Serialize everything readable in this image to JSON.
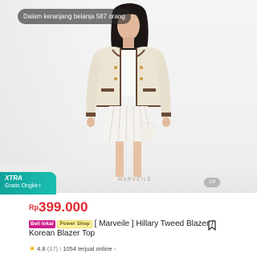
{
  "photo": {
    "cart_badge_prefix": "Dalam keranjang belanja",
    "cart_badge_count": "587",
    "cart_badge_suffix": "orang",
    "watermark": "MARVEILE",
    "page_indicator": "1/9"
  },
  "promo": {
    "xtra_label": "XTRA",
    "shipping_label": "Gratis Ongkir+"
  },
  "product": {
    "currency": "Rp",
    "price": "399.000",
    "badge_lokal": "Beli lokal",
    "badge_power": "Power Shop",
    "title": "[ Marveile ] Hillary Tweed Blazer / Korean Blazer Top"
  },
  "stats": {
    "rating": "4.8",
    "reviews": "(17)",
    "sold": "1054 terjual online"
  },
  "colors": {
    "price": "#e2282d",
    "xtra_bg": "#12ada2",
    "badge_lokal": "#cf1f8b",
    "star": "#f5b400"
  },
  "icons": {
    "bookmark": "bookmark-icon",
    "star": "star-icon",
    "chevron": "chevron-right-icon"
  }
}
